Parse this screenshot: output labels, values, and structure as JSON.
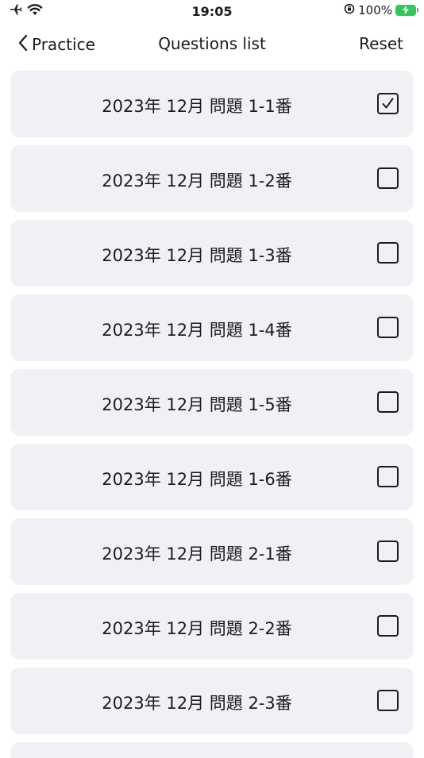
{
  "status_bar": {
    "time": "19:05",
    "battery_text": "100%",
    "icons": [
      "airplane-icon",
      "wifi-icon",
      "orientation-lock-icon",
      "battery-charging-icon"
    ]
  },
  "nav": {
    "back_label": "Practice",
    "title": "Questions list",
    "reset_label": "Reset"
  },
  "questions": [
    {
      "label": "2023年 12月 問題 1-1番",
      "checked": true
    },
    {
      "label": "2023年 12月 問題 1-2番",
      "checked": false
    },
    {
      "label": "2023年 12月 問題 1-3番",
      "checked": false
    },
    {
      "label": "2023年 12月 問題 1-4番",
      "checked": false
    },
    {
      "label": "2023年 12月 問題 1-5番",
      "checked": false
    },
    {
      "label": "2023年 12月 問題 1-6番",
      "checked": false
    },
    {
      "label": "2023年 12月 問題 2-1番",
      "checked": false
    },
    {
      "label": "2023年 12月 問題 2-2番",
      "checked": false
    },
    {
      "label": "2023年 12月 問題 2-3番",
      "checked": false
    }
  ],
  "colors": {
    "row_background": "#f1f1f5",
    "text": "#1c1c1e",
    "battery": "#34c759"
  }
}
